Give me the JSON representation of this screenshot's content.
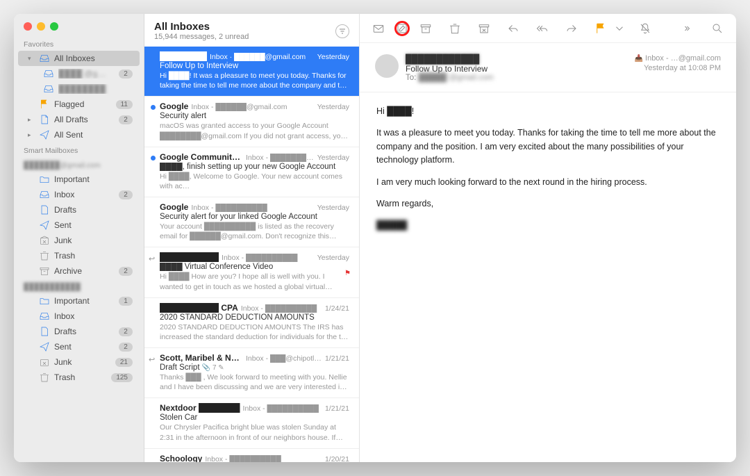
{
  "sidebar": {
    "favorites_label": "Favorites",
    "all_inboxes": "All Inboxes",
    "sub_account_1": "████ @g…",
    "sub_account_1_badge": "2",
    "sub_account_2": "████████",
    "flagged": "Flagged",
    "flagged_badge": "11",
    "all_drafts": "All Drafts",
    "all_drafts_badge": "2",
    "all_sent": "All Sent",
    "smart_label": "Smart Mailboxes",
    "acct1_label": "███████@gmail.com",
    "acct1": {
      "important": "Important",
      "inbox": "Inbox",
      "inbox_badge": "2",
      "drafts": "Drafts",
      "sent": "Sent",
      "junk": "Junk",
      "trash": "Trash",
      "archive": "Archive",
      "archive_badge": "2"
    },
    "acct2_label": "███████████",
    "acct2": {
      "important": "Important",
      "important_badge": "1",
      "inbox": "Inbox",
      "drafts": "Drafts",
      "drafts_badge": "2",
      "sent": "Sent",
      "sent_badge": "2",
      "junk": "Junk",
      "junk_badge": "21",
      "trash": "Trash",
      "trash_badge": "125"
    }
  },
  "list": {
    "title": "All Inboxes",
    "subtitle": "15,944 messages, 2 unread",
    "items": [
      {
        "from": "████████",
        "meta": "Inbox · ██████@gmail.com",
        "date": "Yesterday",
        "subject": "Follow Up to Interview",
        "preview": "Hi ████! It was a pleasure to meet you today. Thanks for taking the time to tell me more about the company and the position. I…",
        "selected": true
      },
      {
        "from": "Google",
        "meta": "Inbox - ██████@gmail.com",
        "date": "Yesterday",
        "subject": "Security alert",
        "preview": "macOS was granted access to your Google Account ████████@gmail.com If you did not grant access, you should c…",
        "unread": true
      },
      {
        "from": "Google Community Team",
        "meta": "Inbox - ███████…",
        "date": "Yesterday",
        "subject": "████, finish setting up your new Google Account",
        "preview": "Hi ████, Welcome to Google. Your new account comes with ac…",
        "unread": true
      },
      {
        "from": "Google",
        "meta": "Inbox - ██████████",
        "date": "Yesterday",
        "subject": "Security alert for your linked Google Account",
        "preview": "Your account ██████████ is listed as the recovery email for ██████@gmail.com. Don't recognize this account…"
      },
      {
        "from": "██████████",
        "meta": "Inbox - ██████████",
        "date": "Yesterday",
        "subject": "████ Virtual Conference Video",
        "preview": "Hi ████ How are you? I hope all is well with you. I wanted to get in touch as we hosted a global virtual conference last year (for…",
        "replied": true,
        "flagged": true
      },
      {
        "from": "██████████ CPA",
        "meta": "Inbox - ██████████",
        "date": "1/24/21",
        "subject": "2020 STANDARD DEDUCTION AMOUNTS",
        "preview": "2020 STANDARD DEDUCTION AMOUNTS The IRS has increased the standard deduction for individuals for the tax year 2020. Bel…"
      },
      {
        "from": "Scott, Maribel & Nellie",
        "meta": "Inbox - ███@chipotlefilm…",
        "date": "1/21/21",
        "subject": "Draft Script",
        "preview": "Thanks ███ , We look forward to meeting with you. Nellie and I have been discussing and we are very interested in your profes…",
        "replied": true,
        "attach": "7"
      },
      {
        "from": "Nextdoor ███████",
        "meta": "Inbox - ██████████",
        "date": "1/21/21",
        "subject": "Stolen Car",
        "preview": "Our Chrysler Pacifica bright blue was stolen Sunday at 2:31 in the afternoon in front of our neighbors house. If anyone has any… V…"
      },
      {
        "from": "Schoology",
        "meta": "Inbox - ██████████",
        "date": "1/20/21",
        "subject": "",
        "preview": ""
      }
    ]
  },
  "pane": {
    "mailbox": "Inbox - …@gmail.com",
    "timestamp": "Yesterday at 10:08 PM",
    "from": "████████████",
    "subject": "Follow Up to Interview",
    "to_label": "To:",
    "to_value": "█████ @gmail.com",
    "body": {
      "p1": "Hi ████!",
      "p2": "It was a pleasure to meet you today. Thanks for taking the time to tell me more about the company and the position. I am very excited about the many possibilities of your technology platform.",
      "p3": "I am very much looking forward to the next round in the hiring process.",
      "p4": "Warm regards,",
      "p5": "█████"
    }
  }
}
